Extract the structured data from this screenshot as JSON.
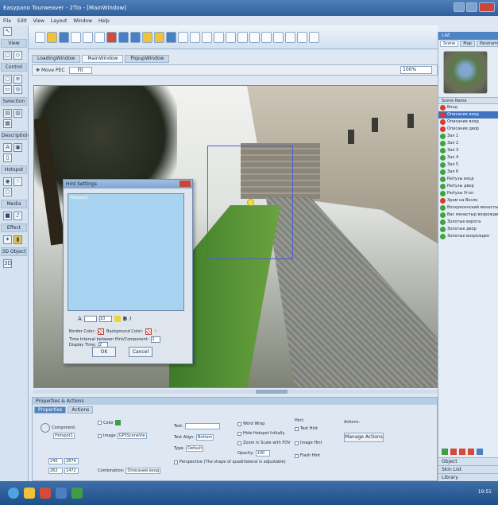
{
  "window": {
    "title": "Easypano Tourweaver - 2Tio - [MainWindow]"
  },
  "menu": [
    "File",
    "Edit",
    "View",
    "Layout",
    "Window",
    "Help"
  ],
  "left_palette": [
    {
      "title": "View"
    },
    {
      "title": "Control"
    },
    {
      "title": "Selection"
    },
    {
      "title": "Description"
    },
    {
      "title": "Hotspot"
    },
    {
      "title": "Media"
    },
    {
      "title": "Effect"
    },
    {
      "title": "3D Object"
    }
  ],
  "tabs": [
    "LoadingWindow",
    "MainWindow",
    "PopupWindow"
  ],
  "subbar": {
    "move_pec": "Move PEC",
    "fit": "Fit",
    "zoom": "100%"
  },
  "dialog": {
    "title": "Hint Settings",
    "hint_text": "Hotspot1",
    "font_size": "10",
    "border_color_label": "Border Color:",
    "bg_color_label": "Background Color:",
    "time_interval_label": "Time Interval between Hint/Component:",
    "time_interval_value": "1",
    "display_time_label": "Display Time:",
    "display_time_value": "2",
    "ok": "OK",
    "cancel": "Cancel"
  },
  "properties": {
    "header": "Properties & Actions",
    "tabs": [
      "Properties",
      "Actions"
    ],
    "component_label": "Component:",
    "component_value": "Hotspot1",
    "color_label": "Color",
    "image_label": "Image",
    "image_value": "GPSSceneVie",
    "text_label": "Text:",
    "text_align_label": "Text Align:",
    "text_align_value": "Bottom",
    "type_label": "Type:",
    "type_value": "Default",
    "word_wrap": "Word Wrap",
    "hide_hotspot": "Hide Hotspot Initially",
    "zoom_scale": "Zoom in Scale with FOV",
    "opacity_label": "Opacity:",
    "opacity_value": "100",
    "perspective": "Perspective (The shape of quadrilateral is adjustable)",
    "hint_label": "Hint:",
    "text_hint": "Text Hint",
    "image_hint": "Image Hint",
    "flash_hint": "Flash Hint",
    "actions_label": "Actions:",
    "manage_actions": "Manage Actions",
    "x_value": "240",
    "x2_value": "2874",
    "y_value": "262",
    "y2_value": "1472",
    "combination_label": "Combination:",
    "combination_value": "Описание вход"
  },
  "right_panel": {
    "header": "List",
    "tabs": [
      "Scene",
      "Map",
      "Panoramic"
    ],
    "list_header": "Scene Name",
    "scenes": [
      {
        "name": "Вход",
        "color": "#d83a2f",
        "selected": false
      },
      {
        "name": "Описание вход",
        "color": "#d83a2f",
        "selected": true
      },
      {
        "name": "Описание вход",
        "color": "#d83a2f",
        "selected": false
      },
      {
        "name": "Описание двор",
        "color": "#d83a2f",
        "selected": false
      },
      {
        "name": "Зал 1",
        "color": "#3ea33f",
        "selected": false
      },
      {
        "name": "Зал 2",
        "color": "#3ea33f",
        "selected": false
      },
      {
        "name": "Зал 3",
        "color": "#3ea33f",
        "selected": false
      },
      {
        "name": "Зал 4",
        "color": "#3ea33f",
        "selected": false
      },
      {
        "name": "Зал 5",
        "color": "#3ea33f",
        "selected": false
      },
      {
        "name": "Зал 6",
        "color": "#3ea33f",
        "selected": false
      },
      {
        "name": "Partyзы вход",
        "color": "#3ea33f",
        "selected": false
      },
      {
        "name": "Partyзы двор",
        "color": "#3ea33f",
        "selected": false
      },
      {
        "name": "Partyзы Угол",
        "color": "#3ea33f",
        "selected": false
      },
      {
        "name": "Храм на Возле",
        "color": "#d83a2f",
        "selected": false
      },
      {
        "name": "Воскресенский монастыр",
        "color": "#3ea33f",
        "selected": false
      },
      {
        "name": "Вас монастыр возрожден",
        "color": "#3ea33f",
        "selected": false
      },
      {
        "name": "Золотые ворота",
        "color": "#3ea33f",
        "selected": false
      },
      {
        "name": "Золотые двор",
        "color": "#3ea33f",
        "selected": false
      },
      {
        "name": "Золотые возрожден",
        "color": "#3ea33f",
        "selected": false
      }
    ],
    "bottom_sections": [
      "Object",
      "Skin List",
      "Library"
    ]
  },
  "taskbar": {
    "clock": "19:51"
  }
}
